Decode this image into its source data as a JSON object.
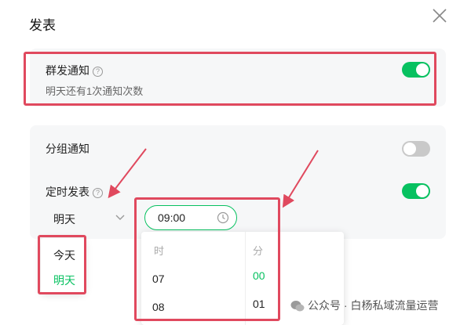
{
  "dialog": {
    "title": "发表"
  },
  "mass_notify": {
    "label": "群发通知",
    "help_glyph": "?",
    "subtext": "明天还有1次通知次数",
    "enabled": true
  },
  "group_notify": {
    "label": "分组通知",
    "enabled": false
  },
  "scheduled": {
    "label": "定时发表",
    "help_glyph": "?",
    "enabled": true,
    "day_value": "明天",
    "time_value": "09:00"
  },
  "day_dropdown": {
    "options": [
      "今天",
      "明天"
    ],
    "selected": "明天"
  },
  "time_picker": {
    "hour_header": "时",
    "minute_header": "分",
    "hours": [
      "07",
      "08"
    ],
    "minutes": [
      "00",
      "01"
    ],
    "selected_minute": "00"
  },
  "watermark": {
    "text": "公众号 · 白杨私域流量运营"
  },
  "colors": {
    "accent": "#07c160",
    "highlight": "#e0495e"
  }
}
